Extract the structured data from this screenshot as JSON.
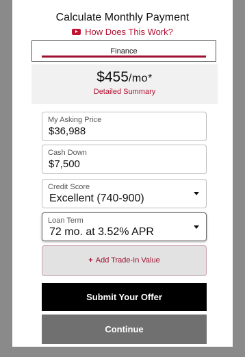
{
  "header": {
    "title": "Calculate Monthly Payment",
    "how_link": "How Does This Work?"
  },
  "tabs": [
    {
      "label": "Finance",
      "active": true
    }
  ],
  "summary": {
    "amount": "$455",
    "unit": "/mo*",
    "detail_link": "Detailed Summary"
  },
  "fields": {
    "asking_price": {
      "label": "My Asking Price",
      "value": "$36,988"
    },
    "cash_down": {
      "label": "Cash Down",
      "value": "$7,500"
    },
    "credit_score": {
      "label": "Credit Score",
      "value": "Excellent (740-900)"
    },
    "loan_term": {
      "label": "Loan Term",
      "value": "72 mo. at 3.52% APR"
    }
  },
  "tradein": {
    "icon": "+",
    "label": "Add Trade-In Value"
  },
  "buttons": {
    "submit": "Submit Your Offer",
    "continue": "Continue"
  },
  "colors": {
    "accent": "#9e1030",
    "submit_bg": "#000000",
    "continue_bg": "#707070",
    "backdrop": "#8a8a8a"
  },
  "icons": {
    "how_link": "play-icon",
    "dropdown": "chevron-down-icon"
  }
}
